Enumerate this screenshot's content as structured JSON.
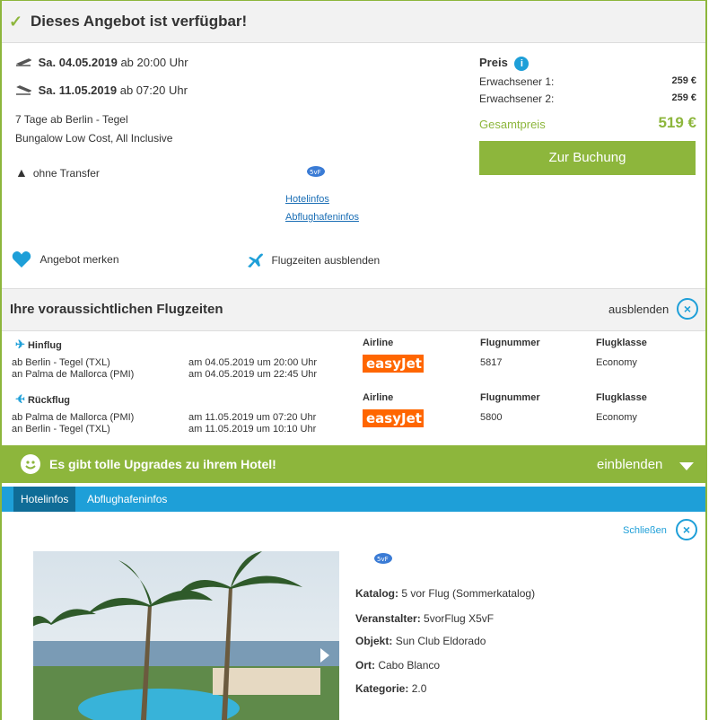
{
  "header": {
    "title": "Dieses Angebot ist verfügbar!"
  },
  "offer": {
    "outbound": {
      "date": "Sa. 04.05.2019",
      "time": "ab 20:00 Uhr"
    },
    "inbound": {
      "date": "Sa. 11.05.2019",
      "time": "ab 07:20 Uhr"
    },
    "duration": "7 Tage ab Berlin - Tegel",
    "room": "Bungalow Low Cost, All Inclusive",
    "transfer": "ohne Transfer",
    "links": {
      "hotel": "Hotelinfos",
      "airport": "Abflughafeninfos"
    },
    "remember": "Angebot merken",
    "hide_flights": "Flugzeiten ausblenden"
  },
  "price": {
    "label": "Preis",
    "adult1_label": "Erwachsener 1:",
    "adult1_value": "259 €",
    "adult2_label": "Erwachsener 2:",
    "adult2_value": "259 €",
    "total_label": "Gesamtpreis",
    "total_value": "519 €",
    "book_button": "Zur Buchung"
  },
  "flights": {
    "title": "Ihre voraussichtlichen Flugzeiten",
    "hide_label": "ausblenden",
    "headers": {
      "airline": "Airline",
      "flight_no": "Flugnummer",
      "class": "Flugklasse"
    },
    "outbound": {
      "label": "Hinflug",
      "from": "ab Berlin - Tegel (TXL)",
      "to": "an Palma de Mallorca (PMI)",
      "dep": "am 04.05.2019 um 20:00 Uhr",
      "arr": "am 04.05.2019 um 22:45 Uhr",
      "airline": "easyJet",
      "number": "5817",
      "class": "Economy"
    },
    "inbound": {
      "label": "Rückflug",
      "from": "ab Palma de Mallorca (PMI)",
      "to": "an Berlin - Tegel (TXL)",
      "dep": "am 11.05.2019 um 07:20 Uhr",
      "arr": "am 11.05.2019 um 10:10 Uhr",
      "airline": "easyJet",
      "number": "5800",
      "class": "Economy"
    }
  },
  "upgrade": {
    "text": "Es gibt tolle Upgrades zu ihrem Hotel!",
    "action": "einblenden"
  },
  "tabs": {
    "hotel": "Hotelinfos",
    "airport": "Abflughafeninfos"
  },
  "hotel": {
    "close": "Schließen",
    "katalog_label": "Katalog:",
    "katalog": "5 vor Flug (Sommerkatalog)",
    "veranstalter_label": "Veranstalter:",
    "veranstalter": "5vorFlug X5vF",
    "objekt_label": "Objekt:",
    "objekt": "Sun Club Eldorado",
    "ort_label": "Ort:",
    "ort": "Cabo Blanco",
    "kategorie_label": "Kategorie:",
    "kategorie": "2.0"
  },
  "colors": {
    "green": "#8db63c",
    "blue": "#1e9fd8",
    "easyjet": "#ff6600"
  }
}
